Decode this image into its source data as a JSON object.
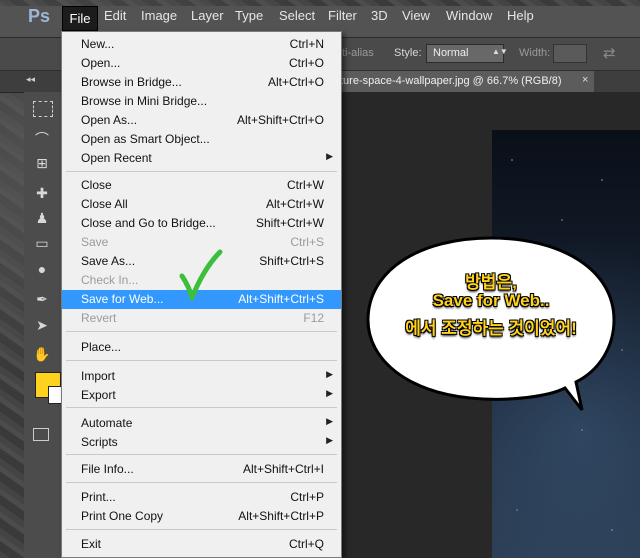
{
  "app": {
    "logo": "Ps"
  },
  "menubar": {
    "items": [
      "File",
      "Edit",
      "Image",
      "Layer",
      "Type",
      "Select",
      "Filter",
      "3D",
      "View",
      "Window",
      "Help"
    ]
  },
  "options_bar": {
    "antialias": "ti-alias",
    "style_label": "Style:",
    "style_value": "Normal",
    "width_label": "Width:"
  },
  "document_tab": {
    "title": "ture-space-4-wallpaper.jpg @ 66.7% (RGB/8)",
    "close": "×"
  },
  "colors": {
    "foreground": "#ffd21e",
    "background": "#ffffff",
    "highlight": "#3298fd",
    "check": "#3cbf3c"
  },
  "file_menu": {
    "items": [
      {
        "label": "New...",
        "shortcut": "Ctrl+N"
      },
      {
        "label": "Open...",
        "shortcut": "Ctrl+O"
      },
      {
        "label": "Browse in Bridge...",
        "shortcut": "Alt+Ctrl+O"
      },
      {
        "label": "Browse in Mini Bridge...",
        "shortcut": ""
      },
      {
        "label": "Open As...",
        "shortcut": "Alt+Shift+Ctrl+O"
      },
      {
        "label": "Open as Smart Object...",
        "shortcut": ""
      },
      {
        "label": "Open Recent",
        "shortcut": "",
        "submenu": true
      },
      {
        "label": "Close",
        "shortcut": "Ctrl+W"
      },
      {
        "label": "Close All",
        "shortcut": "Alt+Ctrl+W"
      },
      {
        "label": "Close and Go to Bridge...",
        "shortcut": "Shift+Ctrl+W"
      },
      {
        "label": "Save",
        "shortcut": "Ctrl+S",
        "disabled": true
      },
      {
        "label": "Save As...",
        "shortcut": "Shift+Ctrl+S"
      },
      {
        "label": "Check In...",
        "shortcut": "",
        "disabled": true
      },
      {
        "label": "Save for Web...",
        "shortcut": "Alt+Shift+Ctrl+S",
        "highlighted": true
      },
      {
        "label": "Revert",
        "shortcut": "F12",
        "disabled": true
      },
      {
        "label": "Place...",
        "shortcut": ""
      },
      {
        "label": "Import",
        "shortcut": "",
        "submenu": true
      },
      {
        "label": "Export",
        "shortcut": "",
        "submenu": true
      },
      {
        "label": "Automate",
        "shortcut": "",
        "submenu": true
      },
      {
        "label": "Scripts",
        "shortcut": "",
        "submenu": true
      },
      {
        "label": "File Info...",
        "shortcut": "Alt+Shift+Ctrl+I"
      },
      {
        "label": "Print...",
        "shortcut": "Ctrl+P"
      },
      {
        "label": "Print One Copy",
        "shortcut": "Alt+Shift+Ctrl+P"
      },
      {
        "label": "Exit",
        "shortcut": "Ctrl+Q"
      }
    ]
  },
  "annotation": {
    "line1": "방법은,",
    "line2": "Save for Web..",
    "line3": "에서 조정하는 것이었어!"
  }
}
